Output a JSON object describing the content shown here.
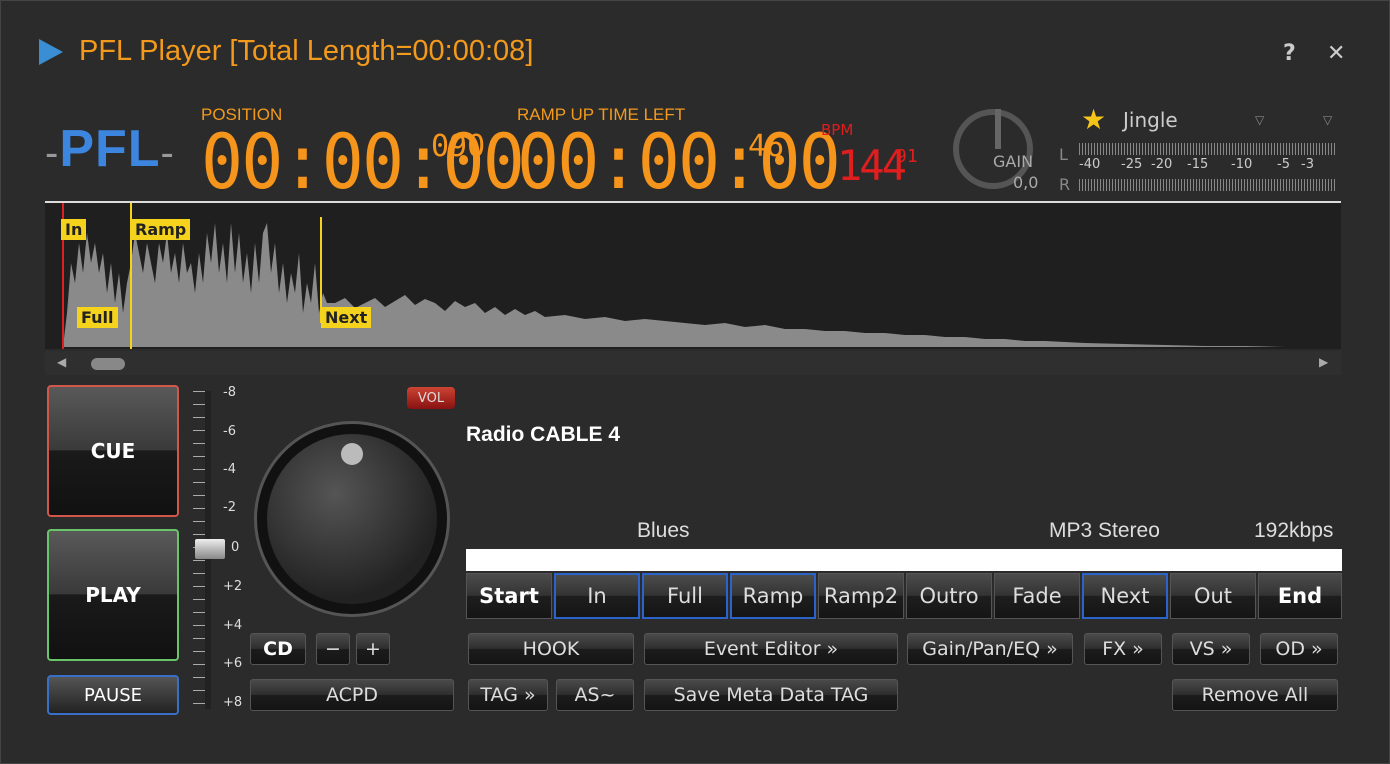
{
  "window": {
    "title": "PFL Player [Total Length=00:00:08]"
  },
  "titlebar": {
    "help": "?",
    "close": "✕"
  },
  "header": {
    "pfl_label": "PFL",
    "position_label": "POSITION",
    "position_value": "00:00:00",
    "position_ms": "090",
    "ramp_label": "RAMP UP TIME LEFT",
    "ramp_value": "00:00:00",
    "ramp_ms": "46",
    "bpm_label": "BPM",
    "bpm_value": "144",
    "bpm_frac": "91",
    "gain_label": "GAIN",
    "gain_value": "0,0",
    "category": "Jingle",
    "meter_l": "L",
    "meter_r": "R",
    "meter_scale": [
      "-40",
      "-25",
      "-20",
      "-15",
      "-10",
      "-5",
      "-3"
    ]
  },
  "waveform": {
    "markers": {
      "in": "In",
      "ramp": "Ramp",
      "full": "Full",
      "next": "Next"
    }
  },
  "transport": {
    "cue": "CUE",
    "play": "PLAY",
    "pause": "PAUSE"
  },
  "pitch": {
    "labels": [
      "-8",
      "-6",
      "-4",
      "-2",
      "0",
      "+2",
      "+4",
      "+6",
      "+8"
    ]
  },
  "volume": {
    "badge": "VOL"
  },
  "controls": {
    "cd": "CD",
    "minus": "−",
    "plus": "+",
    "acpd": "ACPD"
  },
  "track": {
    "station": "Radio CABLE 4",
    "genre": "Blues",
    "format": "MP3 Stereo",
    "bitrate": "192kbps"
  },
  "segments": [
    "Start",
    "In",
    "Full",
    "Ramp",
    "Ramp2",
    "Outro",
    "Fade",
    "Next",
    "Out",
    "End"
  ],
  "actions": {
    "hook": "HOOK",
    "event_editor": "Event Editor »",
    "gain_pan_eq": "Gain/Pan/EQ »",
    "fx": "FX »",
    "vs": "VS »",
    "od": "OD »",
    "tag": "TAG »",
    "as": "AS~",
    "save_meta": "Save Meta Data TAG",
    "remove_all": "Remove All"
  },
  "colors": {
    "accent_orange": "#f6951b",
    "pfl_blue": "#3d86e0",
    "bpm_red": "#e01e1e",
    "marker_yellow": "#f5d21b"
  }
}
